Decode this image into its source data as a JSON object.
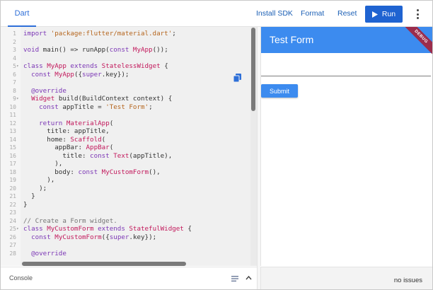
{
  "topbar": {
    "tab_label": "Dart",
    "install_sdk_label": "Install SDK",
    "format_label": "Format",
    "reset_label": "Reset",
    "run_label": "Run"
  },
  "editor": {
    "lines": [
      {
        "n": "1",
        "fold": "",
        "parts": [
          [
            "kw",
            "import "
          ],
          [
            "st",
            "'package:flutter/material.dart'"
          ],
          [
            "",
            "; "
          ]
        ]
      },
      {
        "n": "2",
        "fold": "",
        "parts": []
      },
      {
        "n": "3",
        "fold": "",
        "parts": [
          [
            "kw",
            "void "
          ],
          [
            "",
            "main() => runApp("
          ],
          [
            "kw",
            "const "
          ],
          [
            "ty",
            "MyApp"
          ],
          [
            "",
            "());"
          ]
        ]
      },
      {
        "n": "4",
        "fold": "",
        "parts": []
      },
      {
        "n": "5",
        "fold": "▾",
        "parts": [
          [
            "kw",
            "class "
          ],
          [
            "ty",
            "MyApp "
          ],
          [
            "kw",
            "extends "
          ],
          [
            "ty",
            "StatelessWidget"
          ],
          [
            "",
            " {"
          ]
        ]
      },
      {
        "n": "6",
        "fold": "",
        "parts": [
          [
            "",
            "  "
          ],
          [
            "kw",
            "const "
          ],
          [
            "ty",
            "MyApp"
          ],
          [
            "",
            "({"
          ],
          [
            "kw",
            "super"
          ],
          [
            "",
            ".key});"
          ]
        ]
      },
      {
        "n": "7",
        "fold": "",
        "parts": []
      },
      {
        "n": "8",
        "fold": "",
        "parts": [
          [
            "",
            "  "
          ],
          [
            "an",
            "@override"
          ]
        ]
      },
      {
        "n": "9",
        "fold": "▾",
        "parts": [
          [
            "",
            "  "
          ],
          [
            "ty",
            "Widget "
          ],
          [
            "",
            "build(BuildContext context) {"
          ]
        ]
      },
      {
        "n": "10",
        "fold": "",
        "parts": [
          [
            "",
            "    "
          ],
          [
            "kw",
            "const "
          ],
          [
            "",
            "appTitle = "
          ],
          [
            "st",
            "'Test Form'"
          ],
          [
            "",
            ";"
          ]
        ]
      },
      {
        "n": "11",
        "fold": "",
        "parts": []
      },
      {
        "n": "12",
        "fold": "",
        "parts": [
          [
            "",
            "    "
          ],
          [
            "kw",
            "return "
          ],
          [
            "ty",
            "MaterialApp"
          ],
          [
            "",
            "("
          ]
        ]
      },
      {
        "n": "13",
        "fold": "",
        "parts": [
          [
            "",
            "      title: appTitle,"
          ]
        ]
      },
      {
        "n": "14",
        "fold": "",
        "parts": [
          [
            "",
            "      home: "
          ],
          [
            "ty",
            "Scaffold"
          ],
          [
            "",
            "("
          ]
        ]
      },
      {
        "n": "15",
        "fold": "",
        "parts": [
          [
            "",
            "        appBar: "
          ],
          [
            "ty",
            "AppBar"
          ],
          [
            "",
            "("
          ]
        ]
      },
      {
        "n": "16",
        "fold": "",
        "parts": [
          [
            "",
            "          title: "
          ],
          [
            "kw",
            "const "
          ],
          [
            "ty",
            "Text"
          ],
          [
            "",
            "(appTitle),"
          ]
        ]
      },
      {
        "n": "17",
        "fold": "",
        "parts": [
          [
            "",
            "        ),"
          ]
        ]
      },
      {
        "n": "18",
        "fold": "",
        "parts": [
          [
            "",
            "        body: "
          ],
          [
            "kw",
            "const "
          ],
          [
            "ty",
            "MyCustomForm"
          ],
          [
            "",
            "(),"
          ]
        ]
      },
      {
        "n": "19",
        "fold": "",
        "parts": [
          [
            "",
            "      ),"
          ]
        ]
      },
      {
        "n": "20",
        "fold": "",
        "parts": [
          [
            "",
            "    );"
          ]
        ]
      },
      {
        "n": "21",
        "fold": "",
        "parts": [
          [
            "",
            "  }"
          ]
        ]
      },
      {
        "n": "22",
        "fold": "",
        "parts": [
          [
            "",
            "}"
          ]
        ]
      },
      {
        "n": "23",
        "fold": "",
        "parts": []
      },
      {
        "n": "24",
        "fold": "",
        "parts": [
          [
            "cm",
            "// Create a Form widget."
          ]
        ]
      },
      {
        "n": "25",
        "fold": "▾",
        "parts": [
          [
            "kw",
            "class "
          ],
          [
            "ty",
            "MyCustomForm "
          ],
          [
            "kw",
            "extends "
          ],
          [
            "ty",
            "StatefulWidget"
          ],
          [
            "",
            " {"
          ]
        ]
      },
      {
        "n": "26",
        "fold": "",
        "parts": [
          [
            "",
            "  "
          ],
          [
            "kw",
            "const "
          ],
          [
            "ty",
            "MyCustomForm"
          ],
          [
            "",
            "({"
          ],
          [
            "kw",
            "super"
          ],
          [
            "",
            ".key});"
          ]
        ]
      },
      {
        "n": "27",
        "fold": "",
        "parts": []
      },
      {
        "n": "28",
        "fold": "",
        "parts": [
          [
            "",
            "  "
          ],
          [
            "an",
            "@override"
          ]
        ]
      }
    ]
  },
  "preview": {
    "appbar_title": "Test Form",
    "debug_banner": "DEBUG",
    "submit_label": "Submit"
  },
  "console": {
    "label": "Console"
  },
  "status": {
    "issues": "no issues"
  },
  "colors": {
    "accent": "#1f63d1",
    "appbar": "#3c8bef",
    "debug": "#9b2c4c"
  }
}
